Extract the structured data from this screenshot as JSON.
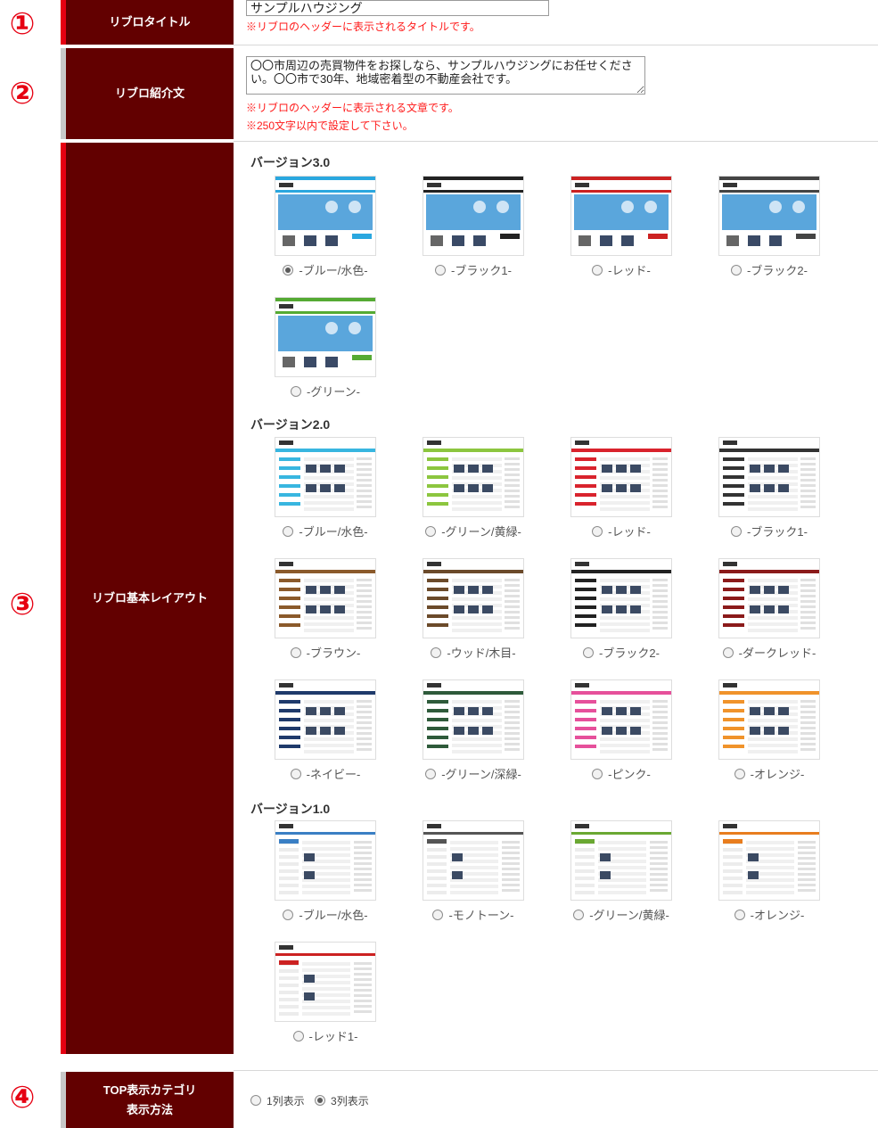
{
  "rows": [
    {
      "number": "①",
      "label": "リブロタイトル"
    },
    {
      "number": "②",
      "label": "リブロ紹介文"
    },
    {
      "number": "③",
      "label": "リブロ基本レイアウト"
    },
    {
      "number": "④",
      "label_line1": "TOP表示カテゴリ",
      "label_line2": "表示方法"
    }
  ],
  "title_field": {
    "value": "サンプルハウジング",
    "note": "※リブロのヘッダーに表示されるタイトルです。"
  },
  "intro_field": {
    "value": "〇〇市周辺の売買物件をお探しなら、サンプルハウジングにお任せください。〇〇市で30年、地域密着型の不動産会社です。",
    "note1": "※リブロのヘッダーに表示される文章です。",
    "note2": "※250文字以内で設定して下さい。"
  },
  "layout": {
    "v3": {
      "heading": "バージョン3.0",
      "options": [
        {
          "label": "-ブルー/水色-",
          "selected": true,
          "accent": "#2aa7df"
        },
        {
          "label": "-ブラック1-",
          "selected": false,
          "accent": "#222222"
        },
        {
          "label": "-レッド-",
          "selected": false,
          "accent": "#cc2222"
        },
        {
          "label": "-ブラック2-",
          "selected": false,
          "accent": "#444444"
        },
        {
          "label": "-グリーン-",
          "selected": false,
          "accent": "#55aa33"
        }
      ]
    },
    "v2": {
      "heading": "バージョン2.0",
      "options": [
        {
          "label": "-ブルー/水色-",
          "selected": false,
          "accent": "#38b6e0"
        },
        {
          "label": "-グリーン/黄緑-",
          "selected": false,
          "accent": "#8cc63f"
        },
        {
          "label": "-レッド-",
          "selected": false,
          "accent": "#d9232d"
        },
        {
          "label": "-ブラック1-",
          "selected": false,
          "accent": "#333333"
        },
        {
          "label": "-ブラウン-",
          "selected": false,
          "accent": "#8b5a2b"
        },
        {
          "label": "-ウッド/木目-",
          "selected": false,
          "accent": "#6b4a2a"
        },
        {
          "label": "-ブラック2-",
          "selected": false,
          "accent": "#222222"
        },
        {
          "label": "-ダークレッド-",
          "selected": false,
          "accent": "#8b1a1a"
        },
        {
          "label": "-ネイビー-",
          "selected": false,
          "accent": "#1f3a6b"
        },
        {
          "label": "-グリーン/深緑-",
          "selected": false,
          "accent": "#2e5a3a"
        },
        {
          "label": "-ピンク-",
          "selected": false,
          "accent": "#e6509b"
        },
        {
          "label": "-オレンジ-",
          "selected": false,
          "accent": "#f0932b"
        }
      ]
    },
    "v1": {
      "heading": "バージョン1.0",
      "options": [
        {
          "label": "-ブルー/水色-",
          "selected": false,
          "accent": "#3a7fc4"
        },
        {
          "label": "-モノトーン-",
          "selected": false,
          "accent": "#555555"
        },
        {
          "label": "-グリーン/黄緑-",
          "selected": false,
          "accent": "#6aa832"
        },
        {
          "label": "-オレンジ-",
          "selected": false,
          "accent": "#e87d1e"
        },
        {
          "label": "-レッド1-",
          "selected": false,
          "accent": "#cc2222"
        }
      ]
    }
  },
  "top_display": {
    "options": [
      {
        "label": "1列表示",
        "selected": false
      },
      {
        "label": "3列表示",
        "selected": true
      }
    ]
  },
  "colors": {
    "label_bg": "#620000",
    "accent_red": "#e60012",
    "note_red": "#ff1a1a"
  }
}
